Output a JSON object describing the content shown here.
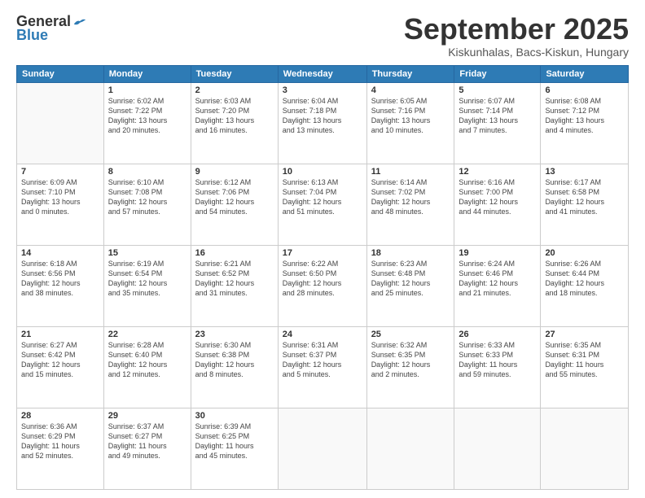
{
  "logo": {
    "general": "General",
    "blue": "Blue"
  },
  "header": {
    "month": "September 2025",
    "location": "Kiskunhalas, Bacs-Kiskun, Hungary"
  },
  "days_of_week": [
    "Sunday",
    "Monday",
    "Tuesday",
    "Wednesday",
    "Thursday",
    "Friday",
    "Saturday"
  ],
  "weeks": [
    [
      {
        "day": "",
        "info": ""
      },
      {
        "day": "1",
        "info": "Sunrise: 6:02 AM\nSunset: 7:22 PM\nDaylight: 13 hours\nand 20 minutes."
      },
      {
        "day": "2",
        "info": "Sunrise: 6:03 AM\nSunset: 7:20 PM\nDaylight: 13 hours\nand 16 minutes."
      },
      {
        "day": "3",
        "info": "Sunrise: 6:04 AM\nSunset: 7:18 PM\nDaylight: 13 hours\nand 13 minutes."
      },
      {
        "day": "4",
        "info": "Sunrise: 6:05 AM\nSunset: 7:16 PM\nDaylight: 13 hours\nand 10 minutes."
      },
      {
        "day": "5",
        "info": "Sunrise: 6:07 AM\nSunset: 7:14 PM\nDaylight: 13 hours\nand 7 minutes."
      },
      {
        "day": "6",
        "info": "Sunrise: 6:08 AM\nSunset: 7:12 PM\nDaylight: 13 hours\nand 4 minutes."
      }
    ],
    [
      {
        "day": "7",
        "info": "Sunrise: 6:09 AM\nSunset: 7:10 PM\nDaylight: 13 hours\nand 0 minutes."
      },
      {
        "day": "8",
        "info": "Sunrise: 6:10 AM\nSunset: 7:08 PM\nDaylight: 12 hours\nand 57 minutes."
      },
      {
        "day": "9",
        "info": "Sunrise: 6:12 AM\nSunset: 7:06 PM\nDaylight: 12 hours\nand 54 minutes."
      },
      {
        "day": "10",
        "info": "Sunrise: 6:13 AM\nSunset: 7:04 PM\nDaylight: 12 hours\nand 51 minutes."
      },
      {
        "day": "11",
        "info": "Sunrise: 6:14 AM\nSunset: 7:02 PM\nDaylight: 12 hours\nand 48 minutes."
      },
      {
        "day": "12",
        "info": "Sunrise: 6:16 AM\nSunset: 7:00 PM\nDaylight: 12 hours\nand 44 minutes."
      },
      {
        "day": "13",
        "info": "Sunrise: 6:17 AM\nSunset: 6:58 PM\nDaylight: 12 hours\nand 41 minutes."
      }
    ],
    [
      {
        "day": "14",
        "info": "Sunrise: 6:18 AM\nSunset: 6:56 PM\nDaylight: 12 hours\nand 38 minutes."
      },
      {
        "day": "15",
        "info": "Sunrise: 6:19 AM\nSunset: 6:54 PM\nDaylight: 12 hours\nand 35 minutes."
      },
      {
        "day": "16",
        "info": "Sunrise: 6:21 AM\nSunset: 6:52 PM\nDaylight: 12 hours\nand 31 minutes."
      },
      {
        "day": "17",
        "info": "Sunrise: 6:22 AM\nSunset: 6:50 PM\nDaylight: 12 hours\nand 28 minutes."
      },
      {
        "day": "18",
        "info": "Sunrise: 6:23 AM\nSunset: 6:48 PM\nDaylight: 12 hours\nand 25 minutes."
      },
      {
        "day": "19",
        "info": "Sunrise: 6:24 AM\nSunset: 6:46 PM\nDaylight: 12 hours\nand 21 minutes."
      },
      {
        "day": "20",
        "info": "Sunrise: 6:26 AM\nSunset: 6:44 PM\nDaylight: 12 hours\nand 18 minutes."
      }
    ],
    [
      {
        "day": "21",
        "info": "Sunrise: 6:27 AM\nSunset: 6:42 PM\nDaylight: 12 hours\nand 15 minutes."
      },
      {
        "day": "22",
        "info": "Sunrise: 6:28 AM\nSunset: 6:40 PM\nDaylight: 12 hours\nand 12 minutes."
      },
      {
        "day": "23",
        "info": "Sunrise: 6:30 AM\nSunset: 6:38 PM\nDaylight: 12 hours\nand 8 minutes."
      },
      {
        "day": "24",
        "info": "Sunrise: 6:31 AM\nSunset: 6:37 PM\nDaylight: 12 hours\nand 5 minutes."
      },
      {
        "day": "25",
        "info": "Sunrise: 6:32 AM\nSunset: 6:35 PM\nDaylight: 12 hours\nand 2 minutes."
      },
      {
        "day": "26",
        "info": "Sunrise: 6:33 AM\nSunset: 6:33 PM\nDaylight: 11 hours\nand 59 minutes."
      },
      {
        "day": "27",
        "info": "Sunrise: 6:35 AM\nSunset: 6:31 PM\nDaylight: 11 hours\nand 55 minutes."
      }
    ],
    [
      {
        "day": "28",
        "info": "Sunrise: 6:36 AM\nSunset: 6:29 PM\nDaylight: 11 hours\nand 52 minutes."
      },
      {
        "day": "29",
        "info": "Sunrise: 6:37 AM\nSunset: 6:27 PM\nDaylight: 11 hours\nand 49 minutes."
      },
      {
        "day": "30",
        "info": "Sunrise: 6:39 AM\nSunset: 6:25 PM\nDaylight: 11 hours\nand 45 minutes."
      },
      {
        "day": "",
        "info": ""
      },
      {
        "day": "",
        "info": ""
      },
      {
        "day": "",
        "info": ""
      },
      {
        "day": "",
        "info": ""
      }
    ]
  ]
}
